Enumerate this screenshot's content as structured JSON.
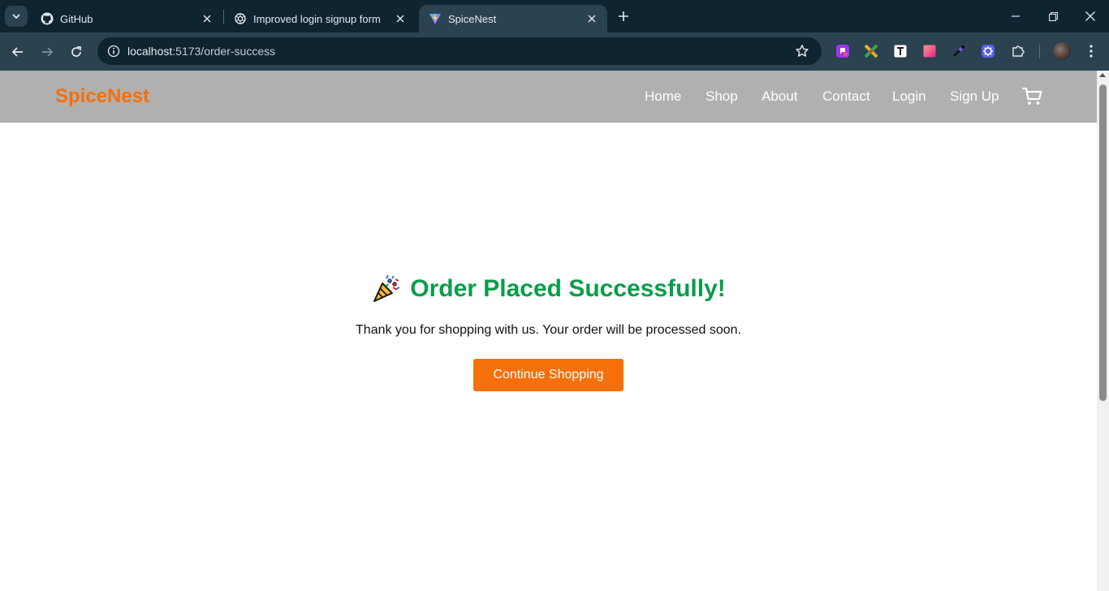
{
  "browser": {
    "tabs": [
      {
        "title": "GitHub",
        "icon": "github-icon",
        "active": false
      },
      {
        "title": "Improved login signup form",
        "icon": "chatgpt-icon",
        "active": false
      },
      {
        "title": "SpiceNest",
        "icon": "vite-icon",
        "active": true
      }
    ],
    "url_host": "localhost",
    "url_path": ":5173/order-success",
    "extensions": [
      "purple-ext-icon",
      "multicolor-x-ext-icon",
      "text-ext-icon",
      "pink-gradient-ext-icon",
      "eyedropper-ext-icon",
      "gear-blue-ext-icon",
      "puzzle-icon"
    ]
  },
  "site": {
    "brand": "SpiceNest",
    "nav": [
      "Home",
      "Shop",
      "About",
      "Contact",
      "Login",
      "Sign Up"
    ],
    "cart_icon": "cart-icon"
  },
  "main": {
    "heading": "Order Placed Successfully!",
    "heading_icon": "party-popper-icon",
    "message": "Thank you for shopping with us. Your order will be processed soon.",
    "button_label": "Continue Shopping"
  },
  "colors": {
    "brand": "#f56f0a",
    "heading": "#0a9d4a",
    "header_bg": "#b0b0b0",
    "button_bg": "#f56f0a"
  }
}
